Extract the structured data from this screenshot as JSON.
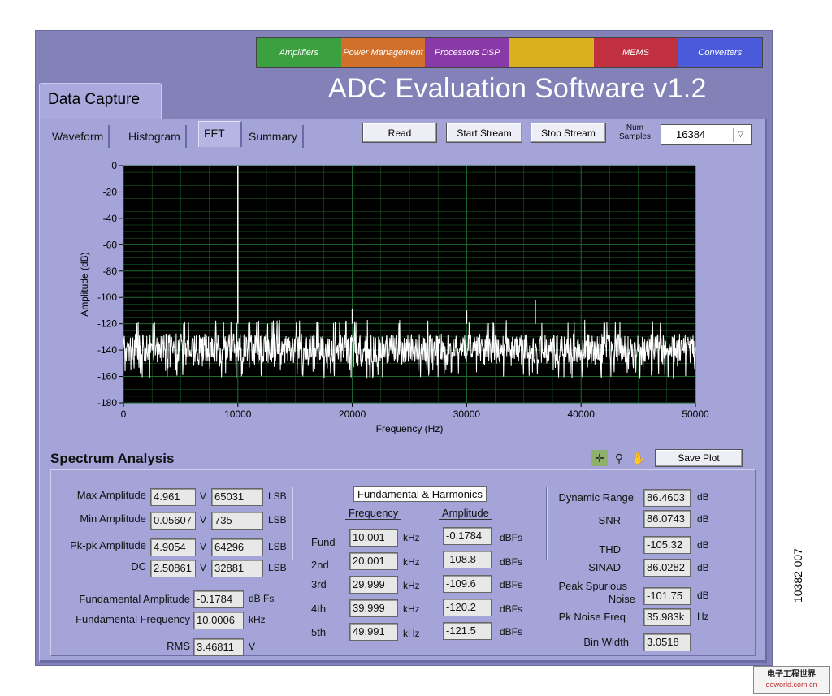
{
  "app": {
    "title": "ADC Evaluation Software v1.2",
    "main_tab": "Data Capture",
    "banner": [
      "Amplifiers",
      "Power Management",
      "Processors DSP",
      "",
      "MEMS",
      "Converters"
    ],
    "banner_colors": [
      "#3aa040",
      "#d0702a",
      "#8a3aa8",
      "#d8b020",
      "#c03040",
      "#4a5ad8"
    ]
  },
  "subtabs": [
    "Waveform",
    "Histogram",
    "FFT",
    "Summary"
  ],
  "active_subtab": "FFT",
  "toolbar": {
    "read": "Read",
    "start_stream": "Start Stream",
    "stop_stream": "Stop Stream",
    "num_samples_label_1": "Num",
    "num_samples_label_2": "Samples",
    "num_samples_value": "16384"
  },
  "chart_data": {
    "type": "line",
    "xlabel": "Frequency (Hz)",
    "ylabel": "Amplitude (dB)",
    "xlim": [
      0,
      50000
    ],
    "ylim": [
      -180,
      0
    ],
    "xticks": [
      0,
      10000,
      20000,
      30000,
      40000,
      50000
    ],
    "yticks": [
      0,
      -20,
      -40,
      -60,
      -80,
      -100,
      -120,
      -140,
      -160,
      -180
    ],
    "grid": true,
    "noise_floor_band": [
      -150,
      -120
    ],
    "peaks": [
      {
        "x": 10000,
        "y": 0
      },
      {
        "x": 20000,
        "y": -109
      },
      {
        "x": 30000,
        "y": -110
      },
      {
        "x": 36000,
        "y": -102
      }
    ],
    "colors": {
      "plot_bg": "#000000",
      "grid": "#1e6b30",
      "trace": "#ffffff"
    }
  },
  "spectrum": {
    "title": "Spectrum Analysis",
    "save_plot": "Save Plot",
    "max_amplitude": {
      "label": "Max Amplitude",
      "v": "4.961",
      "lsb": "65031"
    },
    "min_amplitude": {
      "label": "Min Amplitude",
      "v": "0.05607",
      "lsb": "735"
    },
    "pkpk_amplitude": {
      "label": "Pk-pk Amplitude",
      "v": "4.9054",
      "lsb": "64296"
    },
    "dc": {
      "label": "DC",
      "v": "2.50861",
      "lsb": "32881"
    },
    "unit_v": "V",
    "unit_lsb": "LSB",
    "fundamental_amplitude": {
      "label": "Fundamental Amplitude",
      "value": "-0.1784",
      "unit": "dB Fs"
    },
    "fundamental_frequency": {
      "label": "Fundamental Frequency",
      "value": "10.0006",
      "unit": "kHz"
    },
    "rms": {
      "label": "RMS",
      "value": "3.46811",
      "unit": "V"
    },
    "harmonics": {
      "title": "Fundamental & Harmonics",
      "freq_header": "Frequency",
      "amp_header": "Amplitude",
      "freq_unit": "kHz",
      "amp_unit": "dBFs",
      "rows": [
        {
          "label": "Fund",
          "freq": "10.001",
          "amp": "-0.1784"
        },
        {
          "label": "2nd",
          "freq": "20.001",
          "amp": "-108.8"
        },
        {
          "label": "3rd",
          "freq": "29.999",
          "amp": "-109.6"
        },
        {
          "label": "4th",
          "freq": "39.999",
          "amp": "-120.2"
        },
        {
          "label": "5th",
          "freq": "49.991",
          "amp": "-121.5"
        }
      ]
    },
    "dynamic_range": {
      "label": "Dynamic Range",
      "value": "86.4603",
      "unit": "dB"
    },
    "snr": {
      "label": "SNR",
      "value": "86.0743",
      "unit": "dB"
    },
    "thd": {
      "label": "THD",
      "value": "-105.32",
      "unit": "dB"
    },
    "sinad": {
      "label": "SINAD",
      "value": "86.0282",
      "unit": "dB"
    },
    "peak_spurious": {
      "label_1": "Peak Spurious",
      "label_2": "Noise",
      "value": "-101.75",
      "unit": "dB"
    },
    "pk_noise_freq": {
      "label": "Pk Noise Freq",
      "value": "35.983k",
      "unit": "Hz"
    },
    "bin_width": {
      "label": "Bin Width",
      "value": "3.0518"
    }
  },
  "figure_code": "10382-007",
  "watermark": {
    "line1": "电子工程世界",
    "line2": "eeworld.com.cn"
  }
}
